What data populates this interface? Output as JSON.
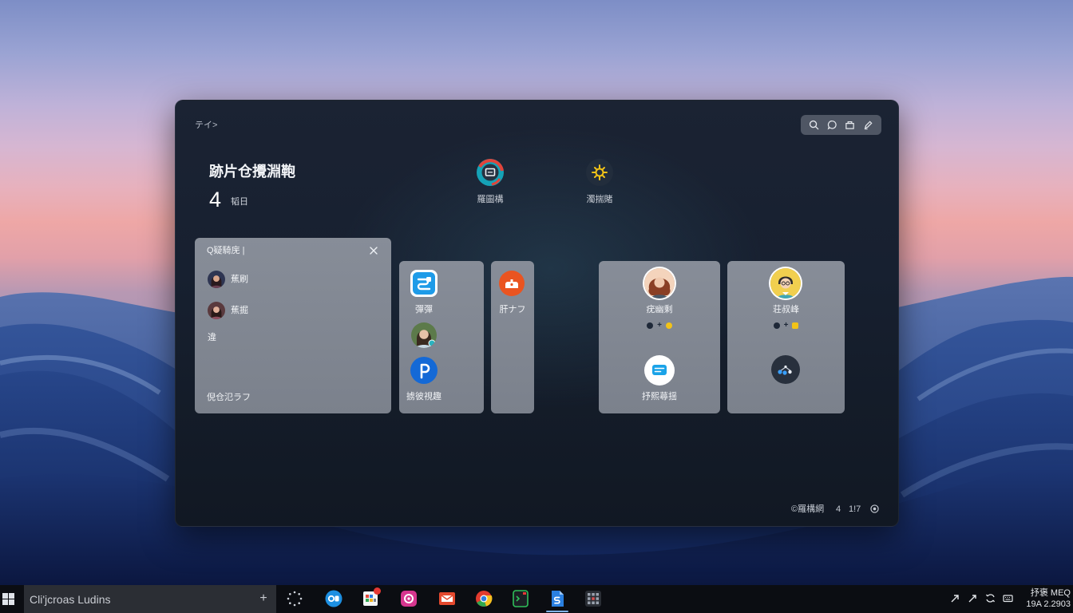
{
  "window": {
    "breadcrumb": "テイ>",
    "toolbar": [
      {
        "icon": "search-icon"
      },
      {
        "icon": "chat-icon"
      },
      {
        "icon": "folder-icon"
      },
      {
        "icon": "pen-icon"
      }
    ],
    "header": {
      "title": "跡片仓攪淵鞄",
      "count": "4",
      "count_label": "韬日"
    },
    "shortcuts": [
      {
        "label": "羅圖構",
        "icon": "screen-ring-icon"
      },
      {
        "label": "濁揣賭",
        "icon": "gear-icon"
      }
    ],
    "list_panel": {
      "title": "Q疑騎庑 |",
      "close_icon": "close-icon",
      "items": [
        {
          "label": "蕉刷",
          "icon": "avatar"
        },
        {
          "label": "蕉掘",
          "icon": "avatar"
        },
        {
          "label": "違"
        }
      ],
      "footer": "倪仓氾ラフ"
    },
    "card_1": {
      "app_icon": "chat-app-icon",
      "app_label": "彈彈",
      "bottom_icon": "pin-icon",
      "bottom_label": "掳彼視趣"
    },
    "card_2": {
      "icon": "scale-icon",
      "label": "肝ナフ"
    },
    "card_3": {
      "name": "疣幽剩",
      "separator": "+",
      "bottom_icon": "message-icon",
      "bottom_label": "抒熙蕁揺"
    },
    "card_4": {
      "name": "荘叔峰",
      "separator": "+",
      "bottom_icon": "network-icon"
    },
    "footer": {
      "label": "©羅構網",
      "count": "4",
      "page": "1!7"
    }
  },
  "taskbar": {
    "search_text": "Cli'jcroas Ludins",
    "add": "+",
    "apps": [
      "blue-chat-icon",
      "spreadsheet-icon",
      "media-icon",
      "mail-icon",
      "browser-icon",
      "terminal-icon",
      "document-icon",
      "apps-grid-icon"
    ],
    "active_app": "document-icon",
    "tray": [
      "arrow-up-right-icon",
      "arrow-icon",
      "sync-icon",
      "keyboard-icon"
    ],
    "clock": {
      "line1": "抒褒 MEQ",
      "line2": "19A 2.2903"
    }
  },
  "colors": {
    "accent_yellow": "#f2c318",
    "window_bg": "#172030",
    "card_bg": "#7e8490",
    "taskbar_bg": "#0b0d12",
    "active_indicator": "#7fb3e8"
  }
}
